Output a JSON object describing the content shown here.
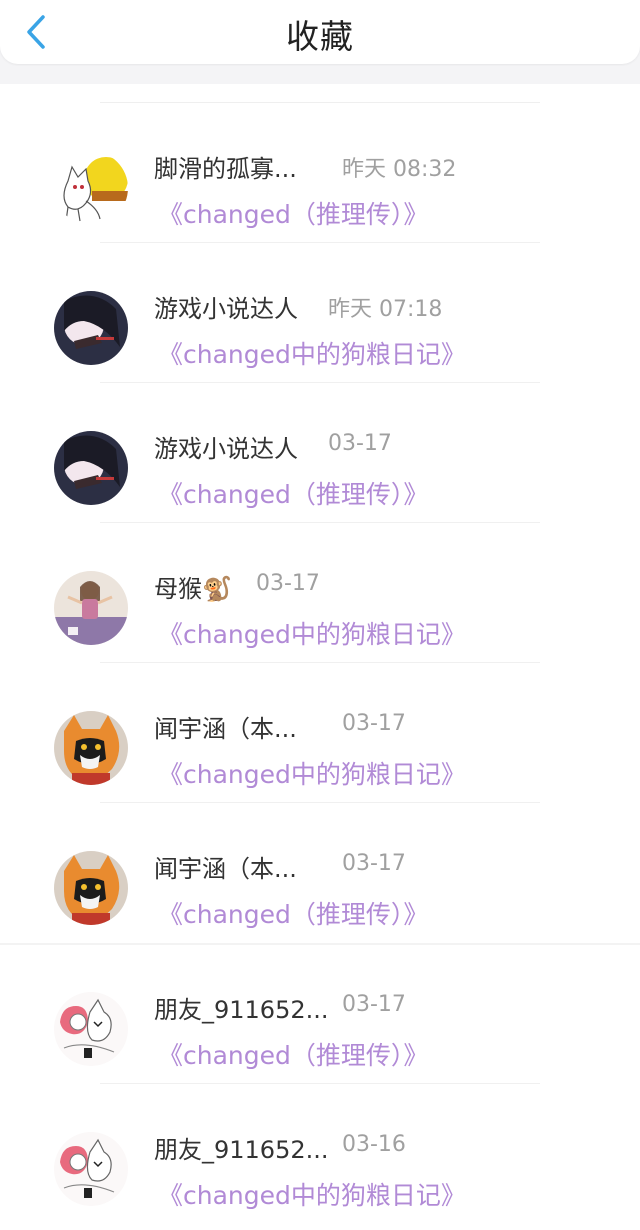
{
  "header": {
    "title": "收藏",
    "back_icon": "chevron-left-icon"
  },
  "colors": {
    "accent": "#b18ad6",
    "back_icon": "#3aa4e6",
    "time": "#a0a0a0",
    "name": "#333333"
  },
  "items": [
    {
      "name": "脚滑的孤寡...",
      "time": "昨天 08:32",
      "title": "《changed（推理传）》",
      "avatar": "cartoon-cat-sketch-avatar"
    },
    {
      "name": "游戏小说达人",
      "time": "昨天 07:18",
      "title": "《changed中的狗粮日记》",
      "avatar": "anime-silhouette-avatar"
    },
    {
      "name": "游戏小说达人",
      "time": "03-17",
      "title": "《changed（推理传）》",
      "avatar": "anime-silhouette-avatar"
    },
    {
      "name": "母猴🐒",
      "time": "03-17",
      "title": "《changed中的狗粮日记》",
      "avatar": "person-photo-avatar"
    },
    {
      "name": "闻宇涵（本...",
      "time": "03-17",
      "title": "《changed中的狗粮日记》",
      "avatar": "furry-costume-avatar"
    },
    {
      "name": "闻宇涵（本...",
      "time": "03-17",
      "title": "《changed（推理传）》",
      "avatar": "furry-costume-avatar"
    },
    {
      "name": "朋友_911652...",
      "time": "03-17",
      "title": "《changed（推理传）》",
      "avatar": "pink-haired-sketch-avatar"
    },
    {
      "name": "朋友_911652...",
      "time": "03-16",
      "title": "《changed中的狗粮日记》",
      "avatar": "pink-haired-sketch-avatar"
    }
  ]
}
